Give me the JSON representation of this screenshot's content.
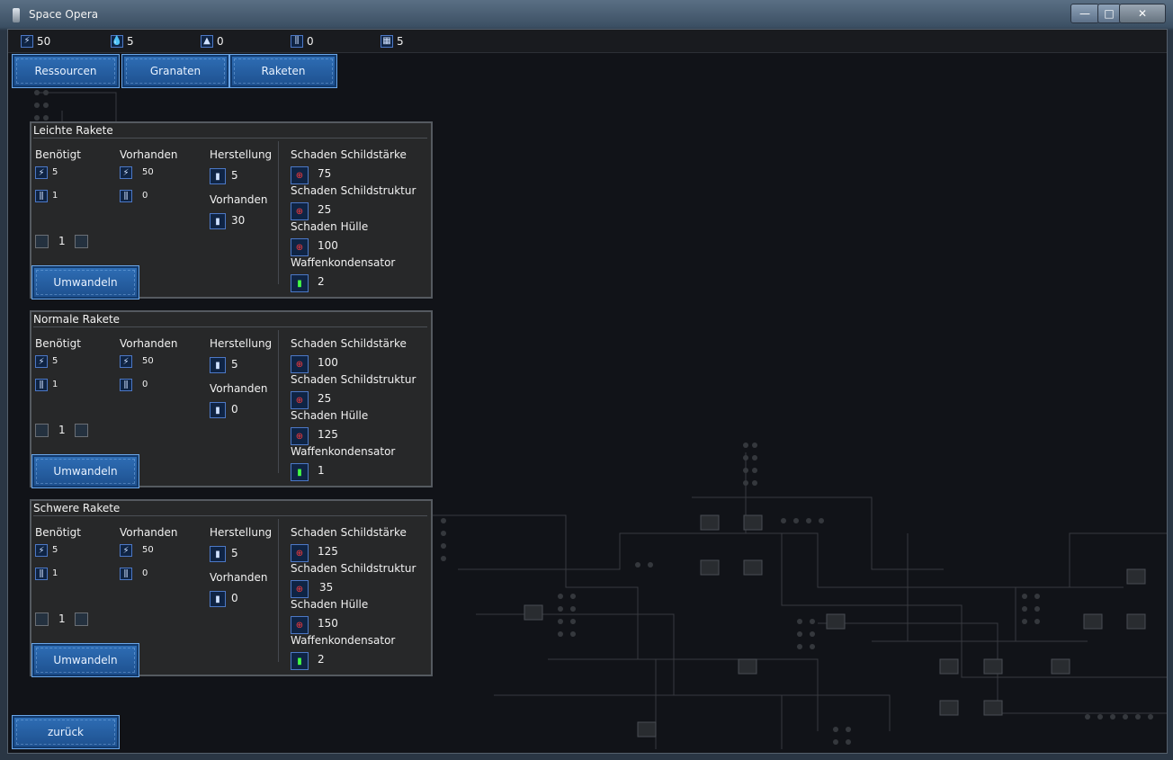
{
  "window": {
    "title": "Space Opera",
    "controls": {
      "minimize": "—",
      "maximize": "□",
      "close": "✕"
    }
  },
  "resources": [
    {
      "icon": "energy-icon",
      "glyph": "⚡",
      "value": "50"
    },
    {
      "icon": "water-icon",
      "glyph": "💧",
      "value": "5"
    },
    {
      "icon": "ore-icon",
      "glyph": "▲",
      "value": "0"
    },
    {
      "icon": "ammo-icon",
      "glyph": "⫼",
      "value": "0"
    },
    {
      "icon": "grid-icon",
      "glyph": "▦",
      "value": "5"
    }
  ],
  "tabs": [
    "Ressourcen",
    "Granaten",
    "Raketen"
  ],
  "labels": {
    "needed": "Benötigt",
    "available": "Vorhanden",
    "production": "Herstellung",
    "available2": "Vorhanden",
    "shield_strength": "Schaden Schildstärke",
    "shield_structure": "Schaden Schildstruktur",
    "hull": "Schaden Hülle",
    "weapon_capacitor": "Waffenkondensator",
    "convert": "Umwandeln"
  },
  "rockets": [
    {
      "name": "Leichte Rakete",
      "needed_energy": "5",
      "needed_ammo": "1",
      "available_energy": "50",
      "available_ammo": "0",
      "amount": "1",
      "production": "5",
      "in_stock": "30",
      "shield_strength": "75",
      "shield_structure": "25",
      "hull": "100",
      "capacitor": "2"
    },
    {
      "name": "Normale Rakete",
      "needed_energy": "5",
      "needed_ammo": "1",
      "available_energy": "50",
      "available_ammo": "0",
      "amount": "1",
      "production": "5",
      "in_stock": "0",
      "shield_strength": "100",
      "shield_structure": "25",
      "hull": "125",
      "capacitor": "1"
    },
    {
      "name": "Schwere Rakete",
      "needed_energy": "5",
      "needed_ammo": "1",
      "available_energy": "50",
      "available_ammo": "0",
      "amount": "1",
      "production": "5",
      "in_stock": "0",
      "shield_strength": "125",
      "shield_structure": "35",
      "hull": "150",
      "capacitor": "2"
    }
  ],
  "back_button": "zurück"
}
